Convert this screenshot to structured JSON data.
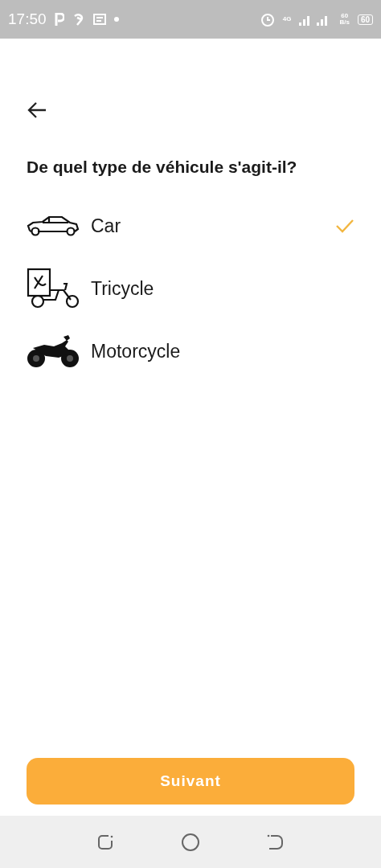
{
  "status_bar": {
    "time": "17:50",
    "network": "4G",
    "speed_value": "60",
    "speed_unit": "B/s",
    "battery": "60"
  },
  "title": "De quel type de véhicule s'agit-il?",
  "options": [
    {
      "kind": "car",
      "label": "Car",
      "selected": true
    },
    {
      "kind": "tricycle",
      "label": "Tricycle",
      "selected": false
    },
    {
      "kind": "motorcycle",
      "label": "Motorcycle",
      "selected": false
    }
  ],
  "button": "Suivant"
}
